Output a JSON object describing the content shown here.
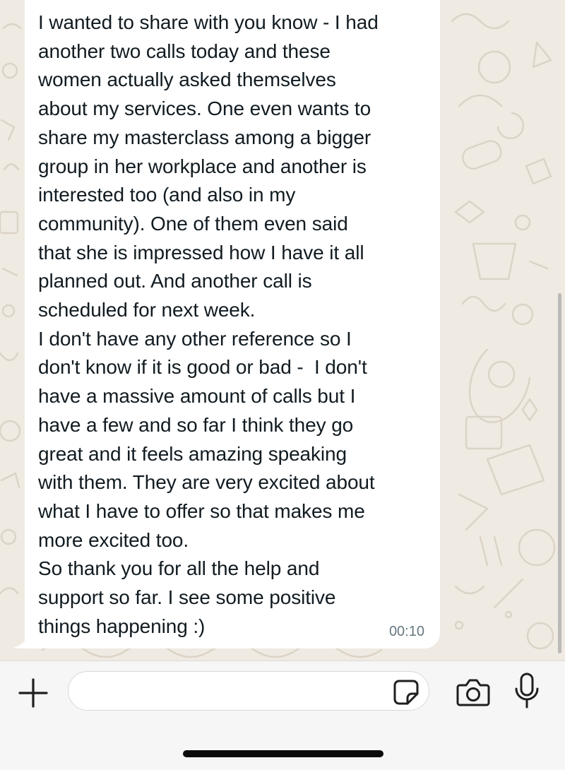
{
  "message": {
    "text": "I wanted to share with you know - I had\nanother two calls today and these\nwomen actually asked themselves\nabout my services. One even wants to\nshare my masterclass among a bigger\ngroup in her workplace and another is\ninterested too (and also in my\ncommunity). One of them even said\nthat she is impressed how I have it all\nplanned out. And another call is\nscheduled for next week.\nI don't have any other reference so I\ndon't know if it is good or bad -  I don't\nhave a massive amount of calls but I\nhave a few and so far I think they go\ngreat and it feels amazing speaking\nwith them. They are very excited about\nwhat I have to offer so that makes me\nmore excited too.\nSo thank you for all the help and\nsupport so far. I see some positive\nthings happening :)",
    "time": "00:10"
  },
  "composer": {
    "input_value": "",
    "icons": {
      "attach": "plus-icon",
      "sticker": "sticker-icon",
      "camera": "camera-icon",
      "microphone": "microphone-icon"
    }
  },
  "colors": {
    "chat_background": "#efeae2",
    "bubble": "#ffffff",
    "text": "#111b21",
    "timestamp": "#667781",
    "toolbar": "#f6f6f6"
  }
}
